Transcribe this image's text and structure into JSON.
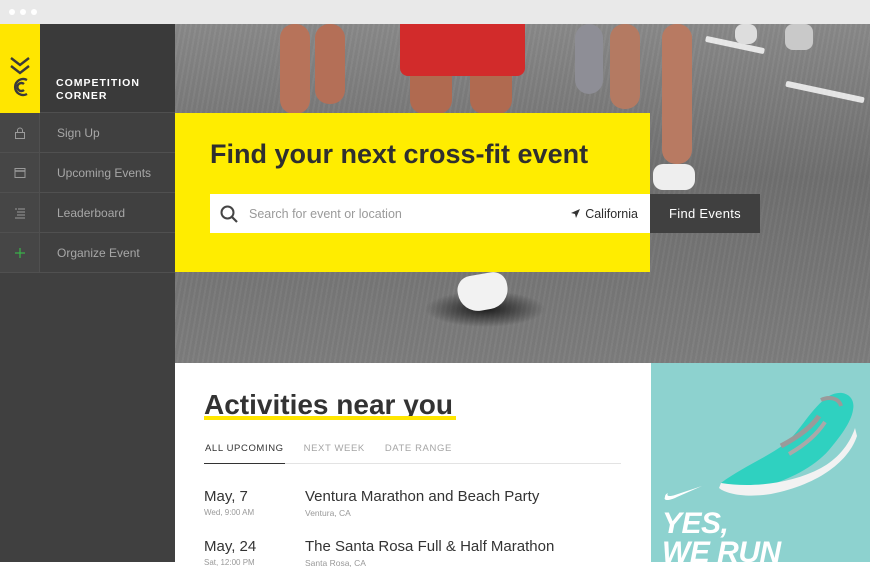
{
  "brand": {
    "name_line1": "COMPETITION",
    "name_line2": "CORNER"
  },
  "nav": [
    {
      "label": "Sign Up",
      "icon": "lock-icon"
    },
    {
      "label": "Upcoming Events",
      "icon": "calendar-icon"
    },
    {
      "label": "Leaderboard",
      "icon": "list-icon"
    },
    {
      "label": "Organize Event",
      "icon": "plus-icon"
    }
  ],
  "hero": {
    "title": "Find your next cross-fit event",
    "search_placeholder": "Search for event or location",
    "location": "California",
    "find_button": "Find Events"
  },
  "activities": {
    "title": "Activities near you",
    "tabs": [
      "ALL UPCOMING",
      "NEXT WEEK",
      "DATE RANGE"
    ],
    "events": [
      {
        "date": "May, 7",
        "time": "Wed, 9:00 AM",
        "name": "Ventura Marathon and Beach Party",
        "place": "Ventura, CA"
      },
      {
        "date": "May, 24",
        "time": "Sat, 12:00 PM",
        "name": "The Santa Rosa Full & Half Marathon",
        "place": "Santa Rosa, CA"
      }
    ]
  },
  "ad": {
    "line1": "YES,",
    "line2": "WE RUN"
  },
  "colors": {
    "accent": "#ffed00",
    "sidebar": "#404040",
    "ad_bg": "#8dd2cf"
  }
}
